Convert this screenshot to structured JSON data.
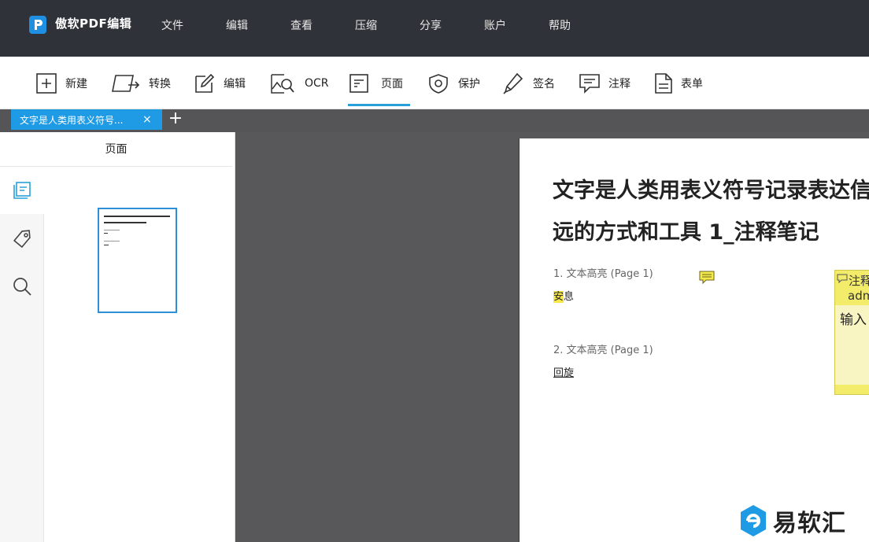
{
  "app": {
    "title": "傲软PDF编辑"
  },
  "menu": [
    "文件",
    "编辑",
    "查看",
    "压缩",
    "分享",
    "账户",
    "帮助"
  ],
  "toolbar": {
    "new": "新建",
    "convert": "转换",
    "edit": "编辑",
    "ocr": "OCR",
    "page": "页面",
    "protect": "保护",
    "sign": "签名",
    "annotate": "注释",
    "form": "表单",
    "active": "page",
    "accent_color": "#2aa0d9"
  },
  "tabs": {
    "current_title": "文字是人类用表义符号...",
    "close_glyph": "×",
    "add_glyph": "+"
  },
  "left_panel": {
    "title": "页面"
  },
  "document": {
    "title_line1": "文字是人类用表义符号记录表达信",
    "title_line2": "远的方式和工具 1_注释笔记",
    "annotations": [
      {
        "heading": "1. 文本高亮  (Page 1)",
        "text_highlight": "安",
        "text_rest": "息"
      },
      {
        "heading": "2. 文本高亮  (Page 1)",
        "text": "回旋"
      }
    ]
  },
  "note_popup": {
    "title": "注释",
    "author": "adm",
    "input_prompt": "输入"
  },
  "watermark": {
    "text": "易软汇"
  }
}
